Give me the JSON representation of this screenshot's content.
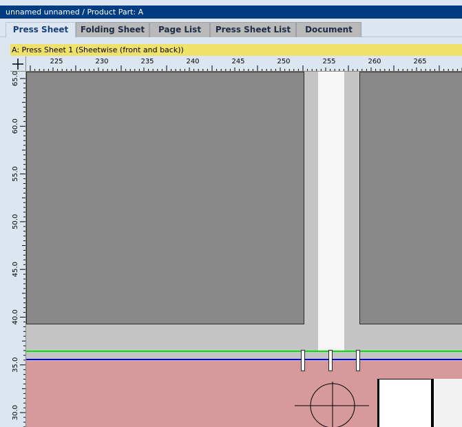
{
  "title_bar": {
    "text": "unnamed unnamed  / Product Part: A"
  },
  "tabs": [
    {
      "label": "Press Sheet",
      "active": true
    },
    {
      "label": "Folding Sheet",
      "active": false
    },
    {
      "label": "Page List",
      "active": false
    },
    {
      "label": "Press Sheet List",
      "active": false
    },
    {
      "label": "Document",
      "active": false
    }
  ],
  "sheet_label": "A:  Press Sheet 1 (Sheetwise (front and back))",
  "ruler_horizontal": {
    "labels": [
      "225",
      "230",
      "235",
      "240",
      "245",
      "250",
      "255",
      "260",
      "265"
    ]
  },
  "ruler_vertical": {
    "labels": [
      "65.0",
      "60.0",
      "55.0",
      "50.0",
      "45.0",
      "40.0",
      "35.0",
      "30.0"
    ]
  },
  "colors": {
    "title_bar_bg": "#003c82",
    "tab_bar_bg": "#dce6f0",
    "sheet_label_bg": "#f0e16a",
    "canvas_bg": "#c4c4c4",
    "page_fill": "#898989",
    "gutter_fill": "#f6f6f6",
    "bleed_fill": "#d79a9a",
    "green_guide": "#00e000",
    "blue_guide": "#0000e0"
  },
  "icons": {
    "corner": "crosshair-icon",
    "register_mark": "registration-mark-icon"
  }
}
